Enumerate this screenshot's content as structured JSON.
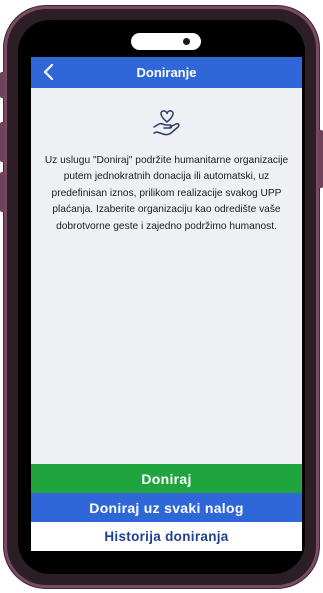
{
  "header": {
    "title": "Doniranje",
    "back_icon": "chevron-left-icon"
  },
  "content": {
    "icon": "hand-heart-icon",
    "description": "Uz uslugu \"Doniraj\" podržite humanitarne organizacije putem jednokratnih donacija ili automatski, uz predefinisan iznos, prilikom realizacije svakog UPP plaćanja. Izaberite organizaciju kao odredište vaše dobrotvorne geste i zajedno podržimo humanost."
  },
  "actions": {
    "donate_label": "Doniraj",
    "donate_recurring_label": "Doniraj uz svaki nalog",
    "history_label": "Historija doniranja"
  },
  "colors": {
    "header_bg": "#2f67d9",
    "donate_green": "#1fa43e",
    "recurring_blue": "#2f67d9",
    "history_text": "#1f3f8f",
    "screen_bg": "#eef0f4",
    "icon_stroke": "#2c3e66"
  }
}
